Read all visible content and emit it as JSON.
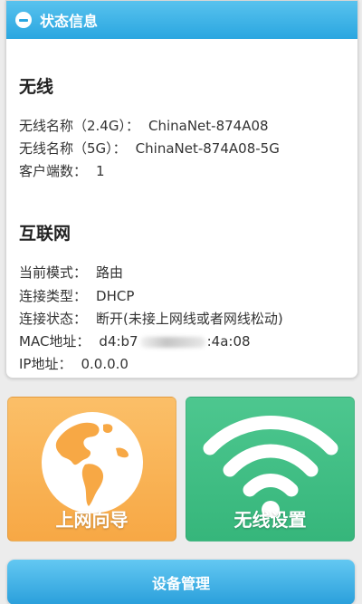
{
  "header": {
    "title": "状态信息"
  },
  "wireless": {
    "title": "无线",
    "name_24g_label": "无线名称（2.4G）：",
    "name_24g_value": "ChinaNet-874A08",
    "name_5g_label": "无线名称（5G）：",
    "name_5g_value": "ChinaNet-874A08-5G",
    "clients_label": "客户端数：",
    "clients_value": "1"
  },
  "internet": {
    "title": "互联网",
    "mode_label": "当前模式：",
    "mode_value": "路由",
    "conn_type_label": "连接类型：",
    "conn_type_value": "DHCP",
    "conn_status_label": "连接状态：",
    "conn_status_value": "断开(未接上网线或者网线松动)",
    "mac_label": "MAC地址：",
    "mac_prefix": "d4:b7",
    "mac_suffix": ":4a:08",
    "ip_label": "IP地址：",
    "ip_value": "0.0.0.0"
  },
  "tiles": {
    "wizard_label": "上网向导",
    "wireless_label": "无线设置"
  },
  "footer": {
    "device_manage_label": "设备管理"
  },
  "colors": {
    "header_blue": "#2aa6e0",
    "wizard_orange": "#f7a845",
    "wireless_green": "#36b67b"
  },
  "icons": {
    "header": "minus-circle-icon",
    "wizard": "globe-icon",
    "wireless": "wifi-icon"
  }
}
